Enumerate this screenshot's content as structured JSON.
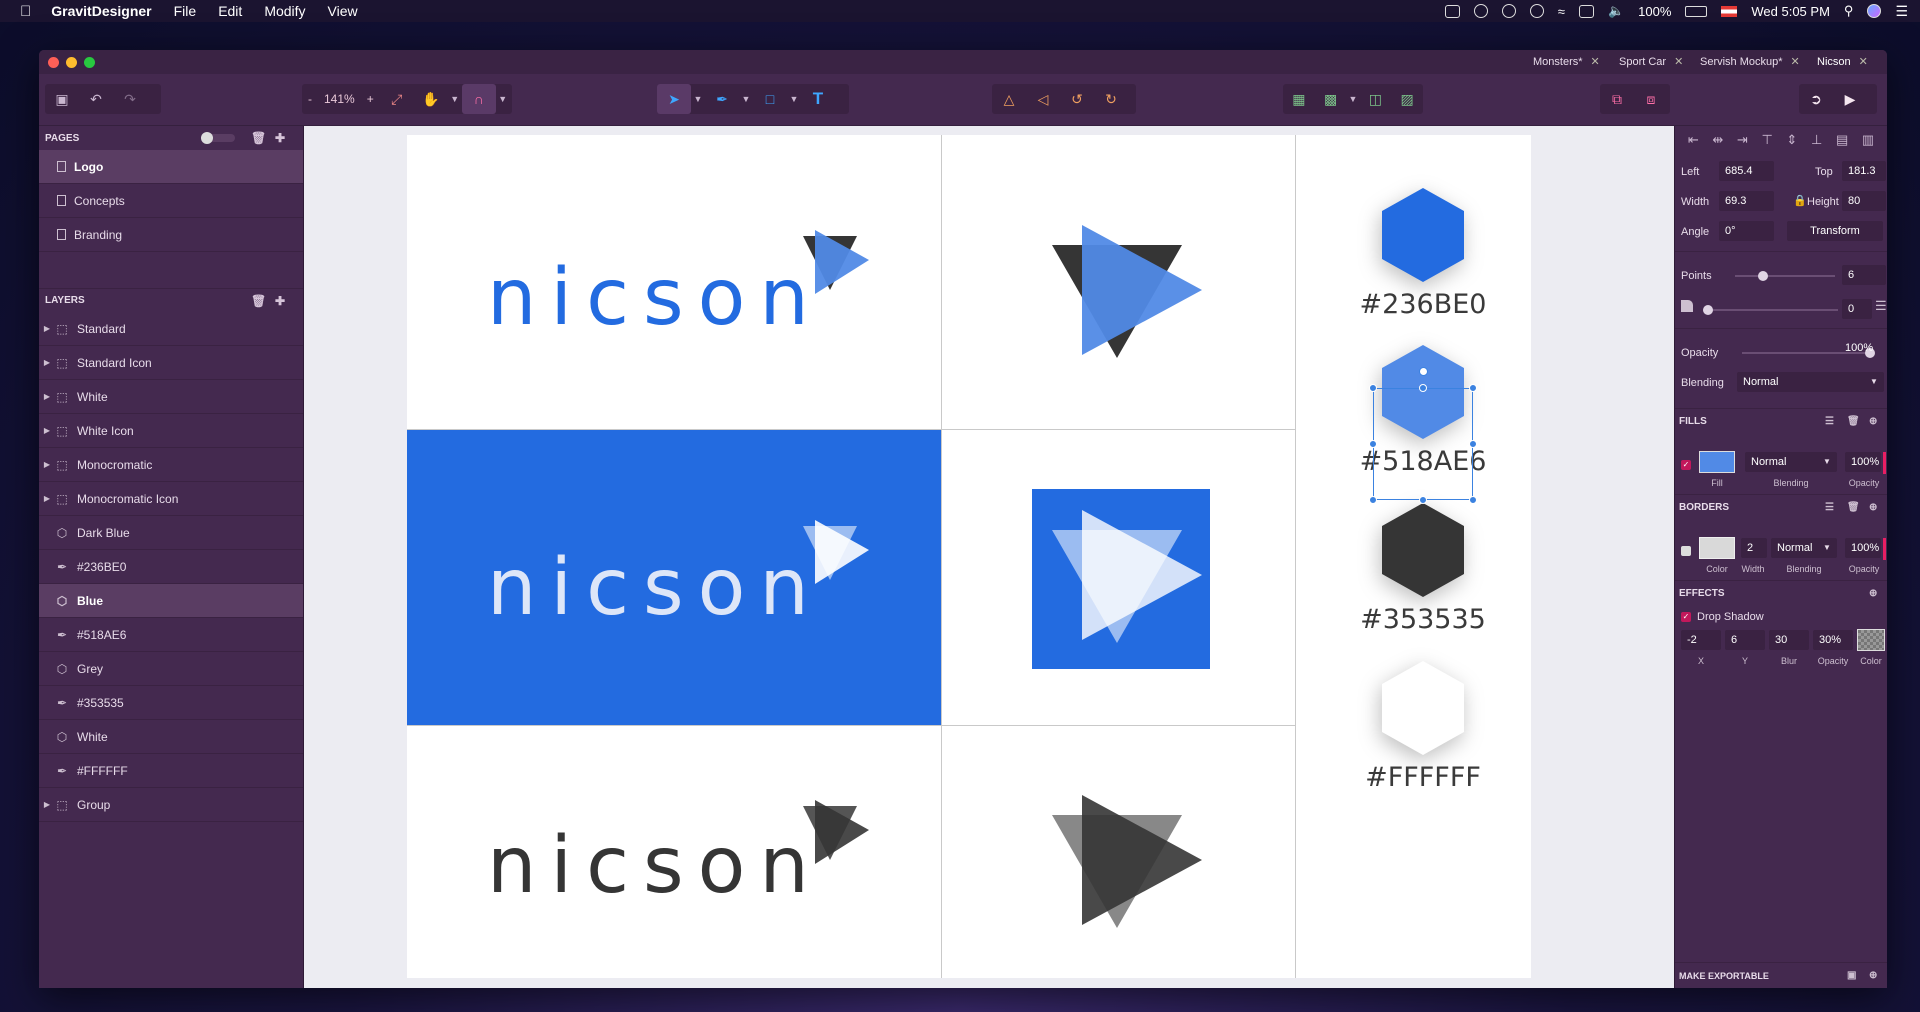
{
  "menubar": {
    "app": "GravitDesigner",
    "items": [
      "File",
      "Edit",
      "Modify",
      "View"
    ],
    "battery": "100%",
    "clock": "Wed 5:05 PM"
  },
  "tabs": [
    {
      "label": "Monsters*"
    },
    {
      "label": "Sport Car"
    },
    {
      "label": "Servish Mockup*"
    },
    {
      "label": "Nicson",
      "active": true
    }
  ],
  "toolbar": {
    "zoom_minus": "-",
    "zoom": "141%",
    "zoom_plus": "+"
  },
  "pages": {
    "header": "PAGES",
    "items": [
      "Logo",
      "Concepts",
      "Branding"
    ],
    "selected": "Logo"
  },
  "layers": {
    "header": "LAYERS",
    "items": [
      {
        "label": "Standard",
        "type": "group"
      },
      {
        "label": "Standard Icon",
        "type": "group"
      },
      {
        "label": "White",
        "type": "group"
      },
      {
        "label": "White Icon",
        "type": "group"
      },
      {
        "label": "Monocromatic",
        "type": "group"
      },
      {
        "label": "Monocromatic Icon",
        "type": "group"
      },
      {
        "label": "Dark Blue",
        "type": "polygon"
      },
      {
        "label": "#236BE0",
        "type": "path"
      },
      {
        "label": "Blue",
        "type": "polygon",
        "selected": true
      },
      {
        "label": "#518AE6",
        "type": "path"
      },
      {
        "label": "Grey",
        "type": "polygon"
      },
      {
        "label": "#353535",
        "type": "path"
      },
      {
        "label": "White",
        "type": "polygon"
      },
      {
        "label": "#FFFFFF",
        "type": "path"
      },
      {
        "label": "Group",
        "type": "group"
      }
    ]
  },
  "artboard": {
    "logo_word": "nicson",
    "colors": {
      "dark_blue": "#236BE0",
      "blue": "#518AE6",
      "grey": "#353535",
      "white": "#FFFFFF",
      "panel_bg": "#236BE0"
    },
    "swatches": [
      {
        "label": "#236BE0",
        "fill": "#236BE0"
      },
      {
        "label": "#518AE6",
        "fill": "#518AE6"
      },
      {
        "label": "#353535",
        "fill": "#353535"
      },
      {
        "label": "#FFFFFF",
        "fill": "#FFFFFF"
      }
    ]
  },
  "inspector": {
    "left_label": "Left",
    "left": "685.4",
    "top_label": "Top",
    "top": "181.3",
    "width_label": "Width",
    "width": "69.3",
    "height_label": "Height",
    "height": "80",
    "angle_label": "Angle",
    "angle": "0°",
    "transform": "Transform",
    "points_label": "Points",
    "points": "6",
    "corner": "0",
    "opacity_label": "Opacity",
    "opacity": "100%",
    "blending_label": "Blending",
    "blending": "Normal",
    "fills_header": "FILLS",
    "fill_blend": "Normal",
    "fill_opacity": "100%",
    "fill_color": "#518AE6",
    "fill_sub": {
      "fill": "Fill",
      "blending": "Blending",
      "opacity": "Opacity"
    },
    "borders_header": "BORDERS",
    "border_width": "2",
    "border_blend": "Normal",
    "border_opacity": "100%",
    "border_sub": {
      "color": "Color",
      "width": "Width",
      "blending": "Blending",
      "opacity": "Opacity"
    },
    "effects_header": "EFFECTS",
    "effect_name": "Drop Shadow",
    "shadow": {
      "x": "-2",
      "y": "6",
      "blur": "30",
      "opacity": "30%"
    },
    "shadow_sub": {
      "x": "X",
      "y": "Y",
      "blur": "Blur",
      "opacity": "Opacity",
      "color": "Color"
    },
    "exportable": "MAKE EXPORTABLE"
  }
}
